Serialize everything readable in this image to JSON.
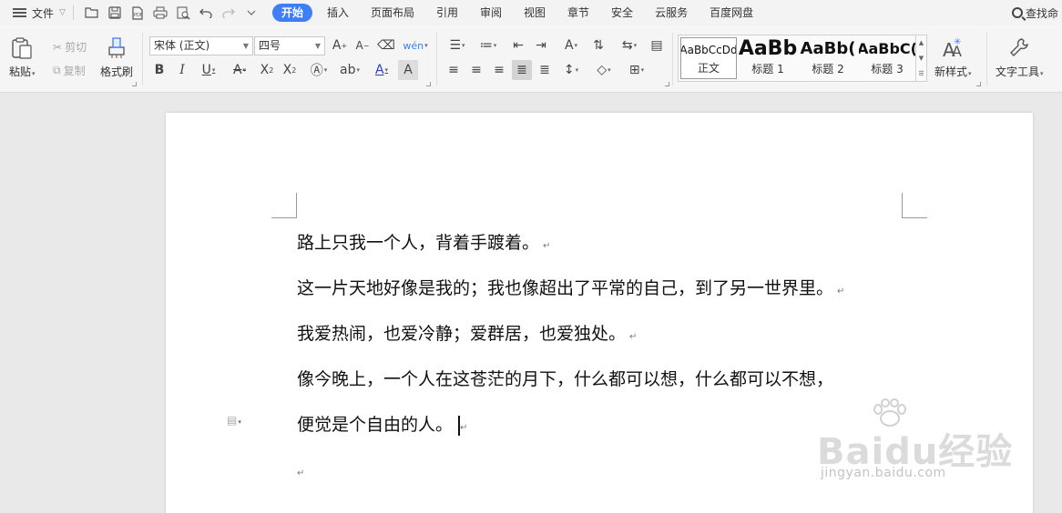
{
  "menubar": {
    "file_label": "文件",
    "tabs": [
      "开始",
      "插入",
      "页面布局",
      "引用",
      "审阅",
      "视图",
      "章节",
      "安全",
      "云服务",
      "百度网盘"
    ],
    "active_tab": "开始",
    "search_label": "查找命"
  },
  "ribbon": {
    "paste_label": "粘贴",
    "cut_label": "剪切",
    "copy_label": "复制",
    "format_painter_label": "格式刷",
    "font_name": "宋体 (正文)",
    "font_size": "四号",
    "styles": [
      {
        "preview": "AaBbCcDd",
        "name": "正文"
      },
      {
        "preview": "AaBb",
        "name": "标题 1"
      },
      {
        "preview": "AaBb(",
        "name": "标题 2"
      },
      {
        "preview": "AaBbC(",
        "name": "标题 3"
      }
    ],
    "new_style_label": "新样式",
    "text_tools_label": "文字工具"
  },
  "document": {
    "paragraphs": [
      "路上只我一个人，背着手踱着。",
      "这一片天地好像是我的；我也像超出了平常的自己，到了另一世界里。",
      "我爱热闹，也爱冷静；爱群居，也爱独处。",
      "像今晚上，一个人在这苍茫的月下，什么都可以想，什么都可以不想，",
      "便觉是个自由的人。"
    ],
    "paragraph_mark": "↵"
  },
  "watermark": {
    "brand": "Baidu经验",
    "url": "jingyan.baidu.com"
  },
  "colors": {
    "accent": "#3f7ef6",
    "ribbon_bg": "#f5f5f5",
    "canvas_bg": "#e9e9e9"
  }
}
